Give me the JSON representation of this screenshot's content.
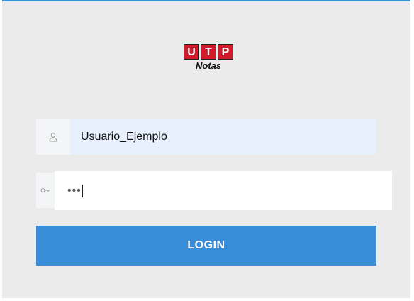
{
  "logo": {
    "letters": [
      "U",
      "T",
      "P"
    ],
    "subtitle": "Notas"
  },
  "username": {
    "value": "Usuario_Ejemplo",
    "icon": "user-icon"
  },
  "password": {
    "masked_value": "•••",
    "icon": "key-icon"
  },
  "login_button": {
    "label": "LOGIN"
  },
  "colors": {
    "accent": "#3a8dd8",
    "logo_red": "#d11a2a",
    "panel_bg": "#ebebeb",
    "autofill_bg": "#e8f0fe"
  }
}
